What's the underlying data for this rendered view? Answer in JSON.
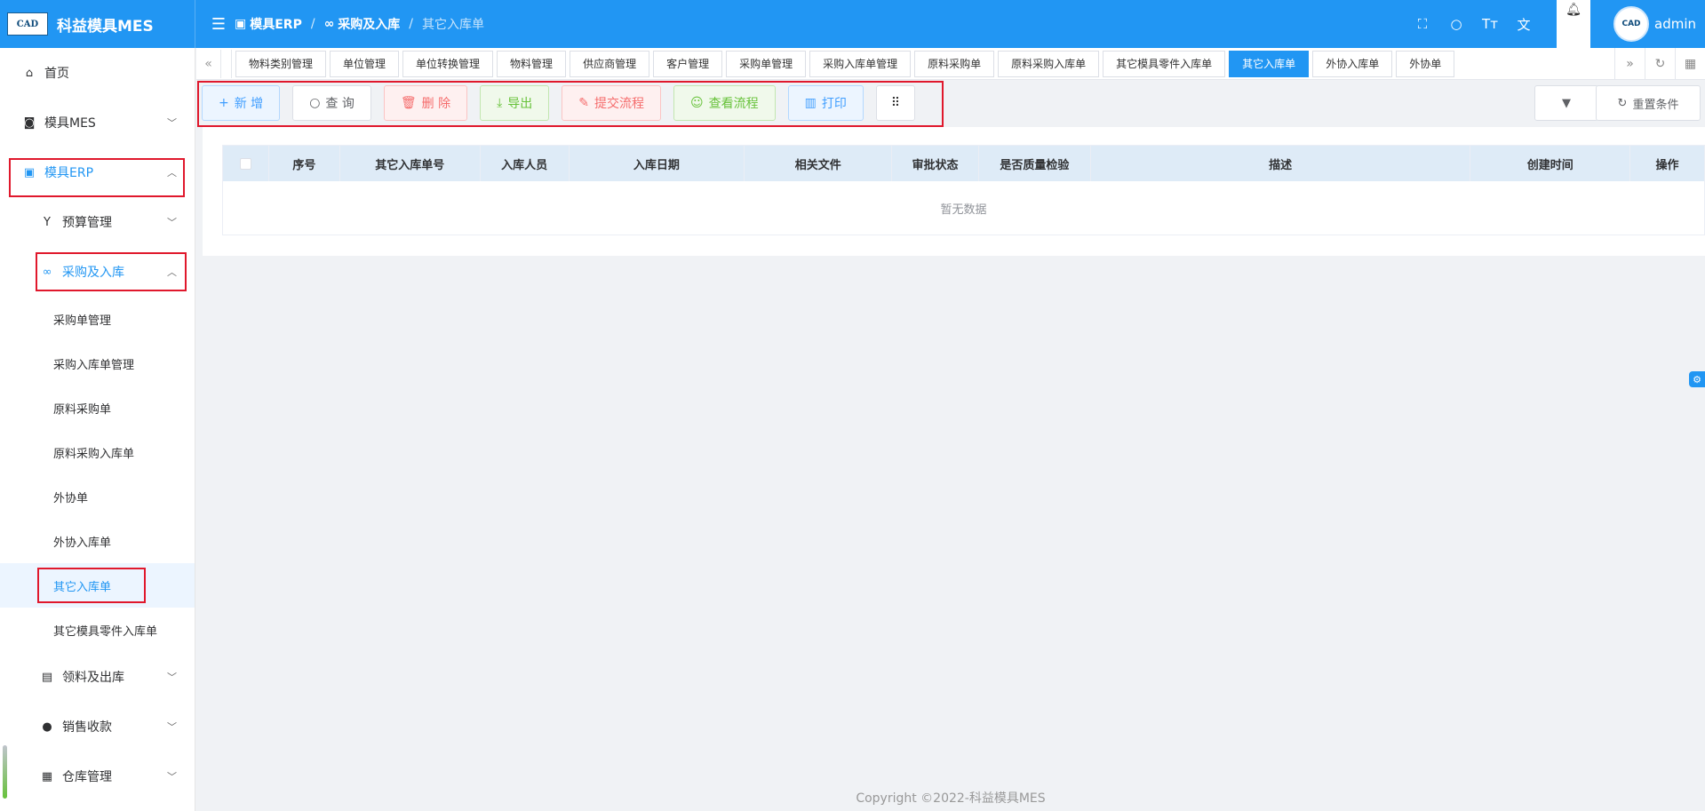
{
  "app": {
    "title": "科益模具MES",
    "logo_text": "CAD"
  },
  "header": {
    "breadcrumb": [
      "模具ERP",
      "采购及入库",
      "其它入库单"
    ],
    "username": "admin"
  },
  "sidebar": {
    "home": "首页",
    "mes": "模具MES",
    "erp": "模具ERP",
    "budget": "预算管理",
    "purchase": "采购及入库",
    "purchase_items": [
      "采购单管理",
      "采购入库单管理",
      "原料采购单",
      "原料采购入库单",
      "外协单",
      "外协入库单",
      "其它入库单",
      "其它模具零件入库单"
    ],
    "material_out": "领料及出库",
    "sales": "销售收款",
    "warehouse": "仓库管理"
  },
  "tags": [
    "物料类别管理",
    "单位管理",
    "单位转换管理",
    "物料管理",
    "供应商管理",
    "客户管理",
    "采购单管理",
    "采购入库单管理",
    "原料采购单",
    "原料采购入库单",
    "其它模具零件入库单",
    "其它入库单",
    "外协入库单",
    "外协单"
  ],
  "toolbar": {
    "add": "新 增",
    "query": "查 询",
    "delete": "删 除",
    "export": "导出",
    "submit": "提交流程",
    "view_flow": "查看流程",
    "print": "打印",
    "reset": "重置条件"
  },
  "table": {
    "columns": [
      "序号",
      "其它入库单号",
      "入库人员",
      "入库日期",
      "相关文件",
      "审批状态",
      "是否质量检验",
      "描述",
      "创建时间",
      "操作"
    ],
    "empty_text": "暂无数据"
  },
  "footer": "Copyright ©2022-科益模具MES",
  "colors": {
    "primary": "#2196f3",
    "highlight": "#e0182c"
  }
}
